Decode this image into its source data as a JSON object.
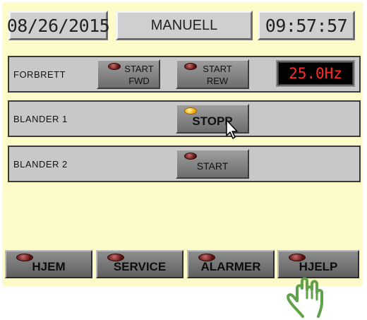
{
  "header": {
    "date": "08/26/2015",
    "mode": "MANUELL",
    "time": "09:57:57"
  },
  "rows": [
    {
      "label": "FORBRETT",
      "buttons": [
        {
          "line1": "START",
          "line2": "FWD",
          "lamp": "off"
        },
        {
          "line1": "START",
          "line2": "REW",
          "lamp": "off"
        }
      ],
      "readout": "25.0Hz"
    },
    {
      "label": "BLANDER 1",
      "buttons": [
        {
          "text": "STOPP",
          "lamp": "on"
        }
      ]
    },
    {
      "label": "BLANDER 2",
      "buttons": [
        {
          "text": "START",
          "lamp": "off"
        }
      ]
    }
  ],
  "nav": [
    {
      "label": "HJEM"
    },
    {
      "label": "SERVICE"
    },
    {
      "label": "ALARMER"
    },
    {
      "label": "HJELP"
    }
  ],
  "colors": {
    "panel_bg": "#fdfbc8",
    "readout_text": "#ff2a2a",
    "hand_outline": "#5fa24a"
  },
  "icons": {
    "pointer": "arrow-cursor-icon",
    "touch": "pointing-hand-icon",
    "lamp": "indicator-lamp-icon"
  }
}
